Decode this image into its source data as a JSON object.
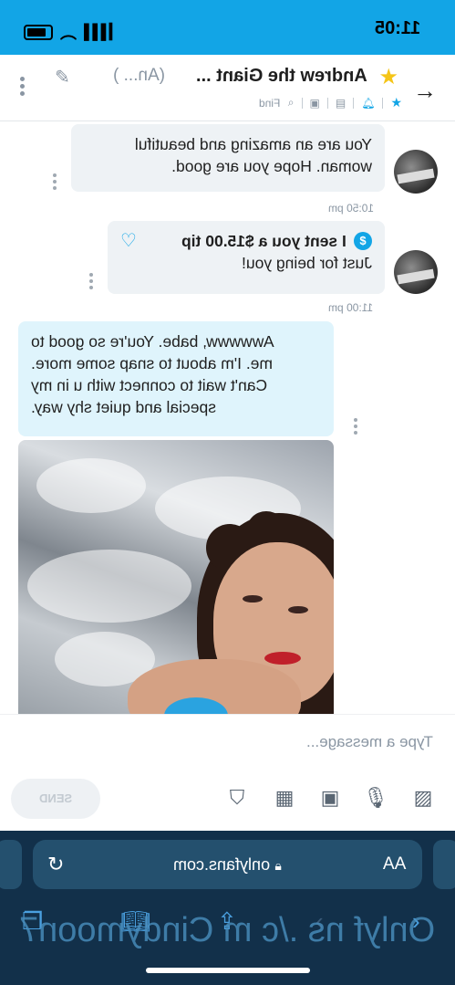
{
  "status_bar": {
    "time": "11:05"
  },
  "header": {
    "name": "Andrew the Giant ...",
    "alias": "(An... )",
    "find_label": "Find"
  },
  "messages": [
    {
      "text_lines": [
        "You are an amazing and beautiful",
        "woman. Hope you are good."
      ],
      "time": "10:50 pm"
    },
    {
      "tip_text": "I sent you a $15.00 tip",
      "text": "Just for being you!",
      "time": "11:00 pm"
    },
    {
      "text_lines": [
        "Awwwww, babe. You're so good to",
        "me. I'm about to snap some more.",
        "Can't wait to connect with u in my",
        "special and quiet shy way."
      ]
    }
  ],
  "composer": {
    "placeholder": "Type a message...",
    "send_label": "SEND"
  },
  "browser": {
    "aa_label": "AA",
    "url": "onlyfans.com"
  },
  "watermark": "Onlyf ns ./c m Cindymoon7",
  "colors": {
    "accent": "#12a5e6",
    "toolbar": "#12304a"
  }
}
